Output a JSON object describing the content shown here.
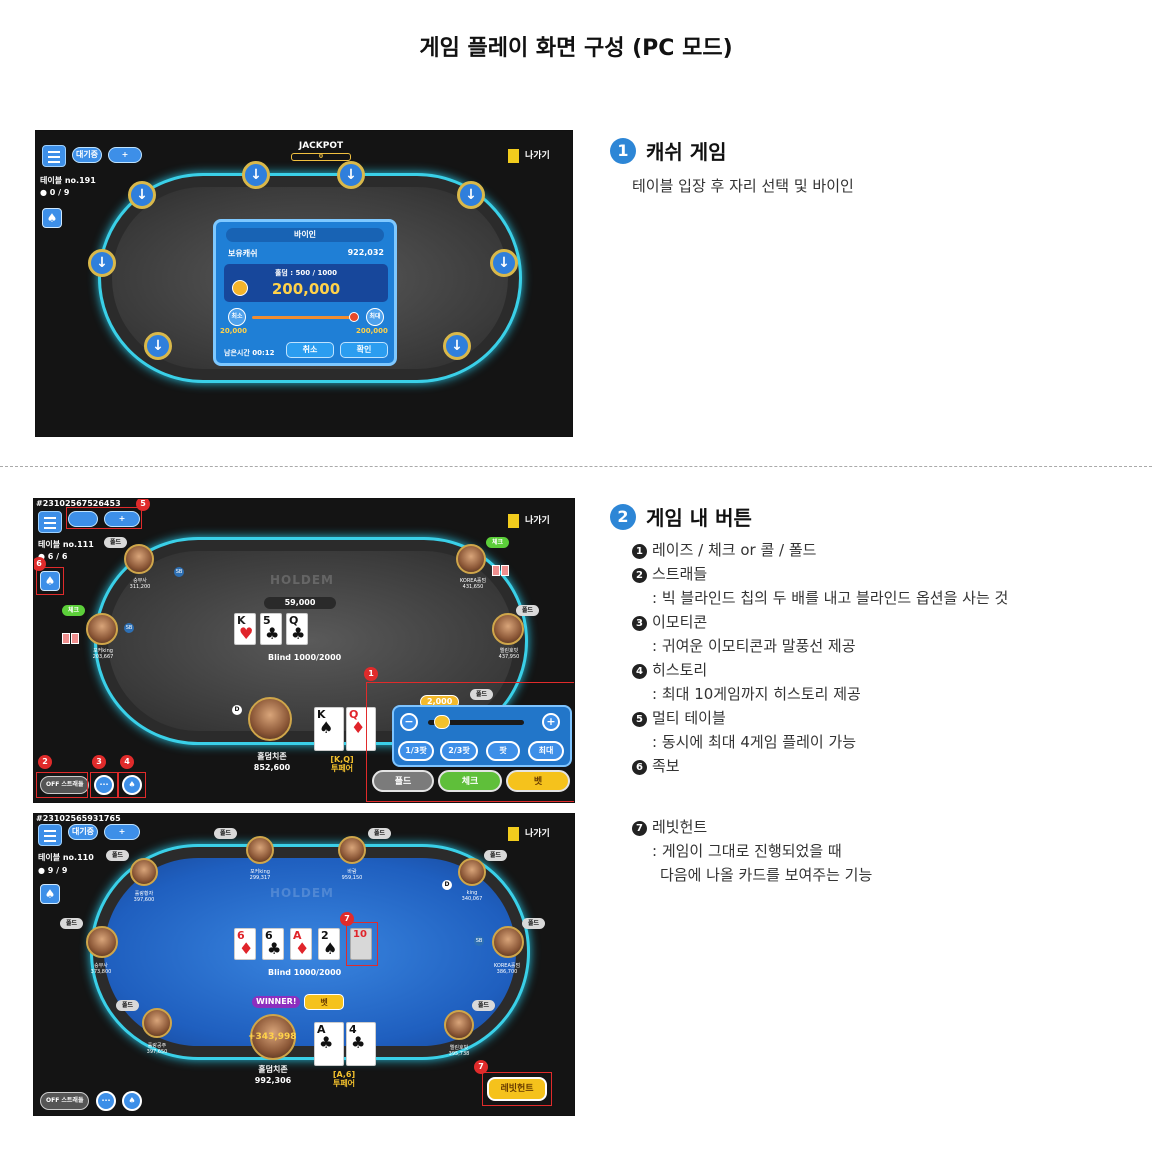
{
  "title": "게임 플레이 화면 구성 (PC 모드)",
  "section1": {
    "number": "1",
    "title": "캐쉬 게임",
    "desc": "테이블 입장 후 자리 선택 및 바이인"
  },
  "section2": {
    "number": "2",
    "title": "게임 내 버튼",
    "items": [
      {
        "num": "1",
        "label": "레이즈 / 체크 or 콜 / 폴드",
        "sub": []
      },
      {
        "num": "2",
        "label": "스트래들",
        "sub": [
          ": 빅 블라인드 칩의 두 배를 내고 블라인드 옵션을 사는 것"
        ]
      },
      {
        "num": "3",
        "label": "이모티콘",
        "sub": [
          ": 귀여운 이모티콘과 말풍선 제공"
        ]
      },
      {
        "num": "4",
        "label": "히스토리",
        "sub": [
          ": 최대 10게임까지 히스토리 제공"
        ]
      },
      {
        "num": "5",
        "label": "멀티 테이블",
        "sub": [
          ": 동시에 최대 4게임 플레이 가능"
        ]
      },
      {
        "num": "6",
        "label": "족보",
        "sub": []
      }
    ],
    "item7": {
      "num": "7",
      "label": "레빗헌트",
      "sub": [
        ": 게임이 그대로 진행되었을 때",
        "다음에 나올 카드를 보여주는 기능"
      ]
    }
  },
  "shot1": {
    "waiting": "대기중",
    "plus": "+",
    "table_no": "테이블 no.191",
    "players": "0 / 9",
    "exit": "나가기",
    "jackpot": "JACKPOT",
    "jackpot_value": "0",
    "buyin_title": "바이인",
    "cash_label": "보유캐쉬",
    "cash_value": "922,032",
    "hold_label": "홀덤 : 500 / 1000",
    "amount": "200,000",
    "min_label": "최소",
    "max_label": "최대",
    "min_value": "20,000",
    "max_value": "200,000",
    "time_left": "남은시간 00:12",
    "cancel": "취소",
    "confirm": "확인"
  },
  "shot2": {
    "game_id": "#23102567526453",
    "plus": "+",
    "table_no": "테이블 no.111",
    "players": "6 / 6",
    "exit": "나가기",
    "logo": "HOLDEM",
    "pot": "59,000",
    "blind": "Blind 1000/2000",
    "board": [
      {
        "rank": "K",
        "suit": "♥",
        "color": "red"
      },
      {
        "rank": "5",
        "suit": "♣",
        "color": "blk"
      },
      {
        "rank": "Q",
        "suit": "♣",
        "color": "blk"
      }
    ],
    "hero_name": "홀덤치존",
    "hero_chips": "852,600",
    "hero_hand": "[K,Q]",
    "hero_hand_name": "투페어",
    "hero_cards": [
      {
        "rank": "K",
        "suit": "♠",
        "color": "blk"
      },
      {
        "rank": "Q",
        "suit": "♦",
        "color": "red"
      }
    ],
    "p_top": {
      "name": "승부사",
      "chips": "311,200",
      "tag": "폴드"
    },
    "p_top_right": {
      "name": "KOREA홀덤",
      "chips": "431,650",
      "tag": "체크"
    },
    "p_left": {
      "name": "포커king",
      "chips": "203,667",
      "tag": "체크"
    },
    "p_right": {
      "name": "엘린호빗",
      "chips": "437,950",
      "tag": "폴드"
    },
    "bet_bubble": "2,000",
    "fold_tag": "폴드",
    "raise_opts": [
      "1/3팟",
      "2/3팟",
      "팟",
      "최대"
    ],
    "actions": {
      "fold": "폴드",
      "check": "체크",
      "bet": "벳"
    },
    "toggle": "OFF 스트래들",
    "markers": [
      "1",
      "2",
      "3",
      "4",
      "5",
      "6"
    ]
  },
  "shot3": {
    "game_id": "#23102565931765",
    "waiting": "대기중",
    "plus": "+",
    "table_no": "테이블 no.110",
    "players": "9 / 9",
    "exit": "나가기",
    "logo": "HOLDEM",
    "blind": "Blind 1000/2000",
    "board": [
      {
        "rank": "6",
        "suit": "♦",
        "color": "red"
      },
      {
        "rank": "6",
        "suit": "♣",
        "color": "blk"
      },
      {
        "rank": "A",
        "suit": "♦",
        "color": "red"
      },
      {
        "rank": "2",
        "suit": "♠",
        "color": "blk"
      },
      {
        "rank": "10",
        "suit": "",
        "color": "red"
      }
    ],
    "winner": "WINNER!",
    "win_bet": "벳",
    "win_amount": "+343,998",
    "hero_name": "홀덤치존",
    "hero_chips": "992,306",
    "hero_hand": "[A,6]",
    "hero_hand_name": "투페어",
    "hero_cards": [
      {
        "rank": "A",
        "suit": "♣",
        "color": "blk"
      },
      {
        "rank": "4",
        "suit": "♣",
        "color": "blk"
      }
    ],
    "players_list": [
      {
        "name": "포커king",
        "chips": "299,317",
        "tag": "폴드"
      },
      {
        "name": "바람",
        "chips": "959,150",
        "tag": "폴드"
      },
      {
        "name": "훌랑황자",
        "chips": "397,600",
        "tag": "폴드"
      },
      {
        "name": "king",
        "chips": "340,067",
        "tag": "폴드"
      },
      {
        "name": "승부사",
        "chips": "373,800",
        "tag": "폴드"
      },
      {
        "name": "KOREA홀덤",
        "chips": "386,700",
        "tag": "폴드"
      },
      {
        "name": "훌랑공주",
        "chips": "397,650",
        "tag": "폴드"
      },
      {
        "name": "엘린호빗",
        "chips": "395,738",
        "tag": "폴드"
      }
    ],
    "rabbit_button": "레빗헌트",
    "toggle": "OFF 스트래들",
    "marker": "7"
  }
}
